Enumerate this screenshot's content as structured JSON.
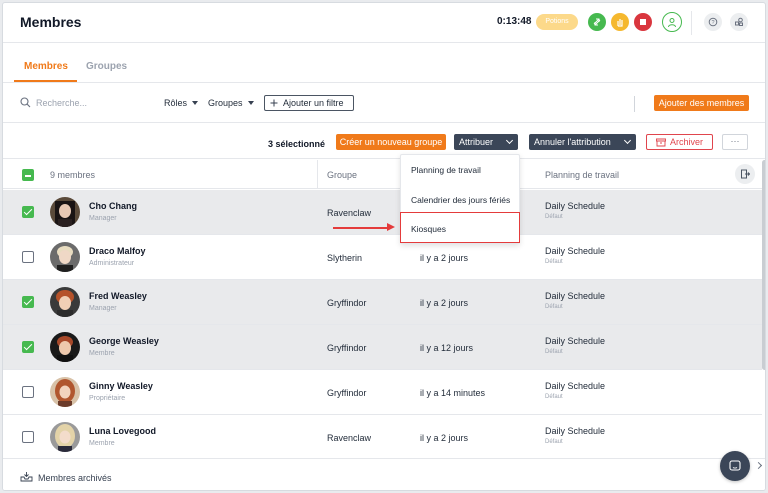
{
  "header": {
    "title": "Membres",
    "timer": "0:13:48",
    "project_pill": "Potions"
  },
  "tabs": [
    {
      "label": "Membres",
      "active": true
    },
    {
      "label": "Groupes",
      "active": false
    }
  ],
  "filters": {
    "search_placeholder": "Recherche...",
    "roles_label": "Rôles",
    "groups_label": "Groupes",
    "add_filter_label": "Ajouter un filtre",
    "add_members_label": "Ajouter des membres"
  },
  "actions": {
    "selected_count": "3 sélectionné",
    "new_group_label": "Créer un nouveau groupe",
    "assign_label": "Attribuer",
    "unassign_label": "Annuler l'attribution",
    "archive_label": "Archiver",
    "more_label": "···"
  },
  "table": {
    "count_label": "9 membres",
    "col_group": "Groupe",
    "col_schedule": "Planning de travail",
    "rows": [
      {
        "name": "Cho Chang",
        "role": "Manager",
        "group": "Ravenclaw",
        "seen": "",
        "schedule": "Daily Schedule",
        "schedule_sub": "Défaut",
        "checked": true
      },
      {
        "name": "Draco Malfoy",
        "role": "Administrateur",
        "group": "Slytherin",
        "seen": "il y a 2 jours",
        "schedule": "Daily Schedule",
        "schedule_sub": "Défaut",
        "checked": false
      },
      {
        "name": "Fred Weasley",
        "role": "Manager",
        "group": "Gryffindor",
        "seen": "il y a 2 jours",
        "schedule": "Daily Schedule",
        "schedule_sub": "Défaut",
        "checked": true
      },
      {
        "name": "George Weasley",
        "role": "Membre",
        "group": "Gryffindor",
        "seen": "il y a 12 jours",
        "schedule": "Daily Schedule",
        "schedule_sub": "Défaut",
        "checked": true
      },
      {
        "name": "Ginny Weasley",
        "role": "Propriétaire",
        "group": "Gryffindor",
        "seen": "il y a 14 minutes",
        "schedule": "Daily Schedule",
        "schedule_sub": "Défaut",
        "checked": false
      },
      {
        "name": "Luna Lovegood",
        "role": "Membre",
        "group": "Ravenclaw",
        "seen": "il y a 2 jours",
        "schedule": "Daily Schedule",
        "schedule_sub": "Défaut",
        "checked": false
      }
    ]
  },
  "dropdown": {
    "items": [
      "Planning de travail",
      "Calendrier des jours fériés",
      "Kiosques"
    ]
  },
  "footer": {
    "archived_label": "Membres archivés"
  },
  "colors": {
    "accent": "#f07a1a",
    "success": "#46b94f",
    "danger": "#e0454d",
    "dark_button": "#3b4658"
  }
}
